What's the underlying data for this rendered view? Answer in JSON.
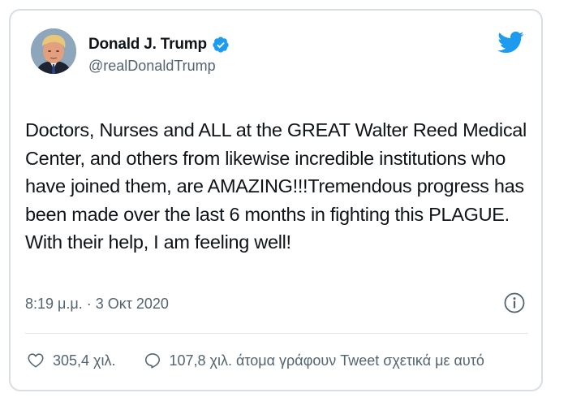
{
  "author": {
    "name": "Donald J. Trump",
    "handle": "@realDonaldTrump"
  },
  "tweet": {
    "text": "Doctors, Nurses and ALL at the GREAT Walter Reed Medical Center, and others from likewise incredible institutions who have joined them, are AMAZING!!!Tremendous progress has been made over the last 6 months in fighting this PLAGUE. With their help, I am feeling well!",
    "timestamp": "8:19 μ.μ. · 3 Οκτ 2020"
  },
  "actions": {
    "likes": "305,4 χιλ.",
    "conversation": "107,8 χιλ. άτομα γράφουν Tweet σχετικά με αυτό"
  },
  "colors": {
    "twitter_blue": "#1d9bf0",
    "text": "#0f1419",
    "secondary": "#536471"
  },
  "icons": [
    "verified-badge-icon",
    "twitter-bird-icon",
    "info-icon",
    "heart-icon",
    "reply-icon"
  ]
}
